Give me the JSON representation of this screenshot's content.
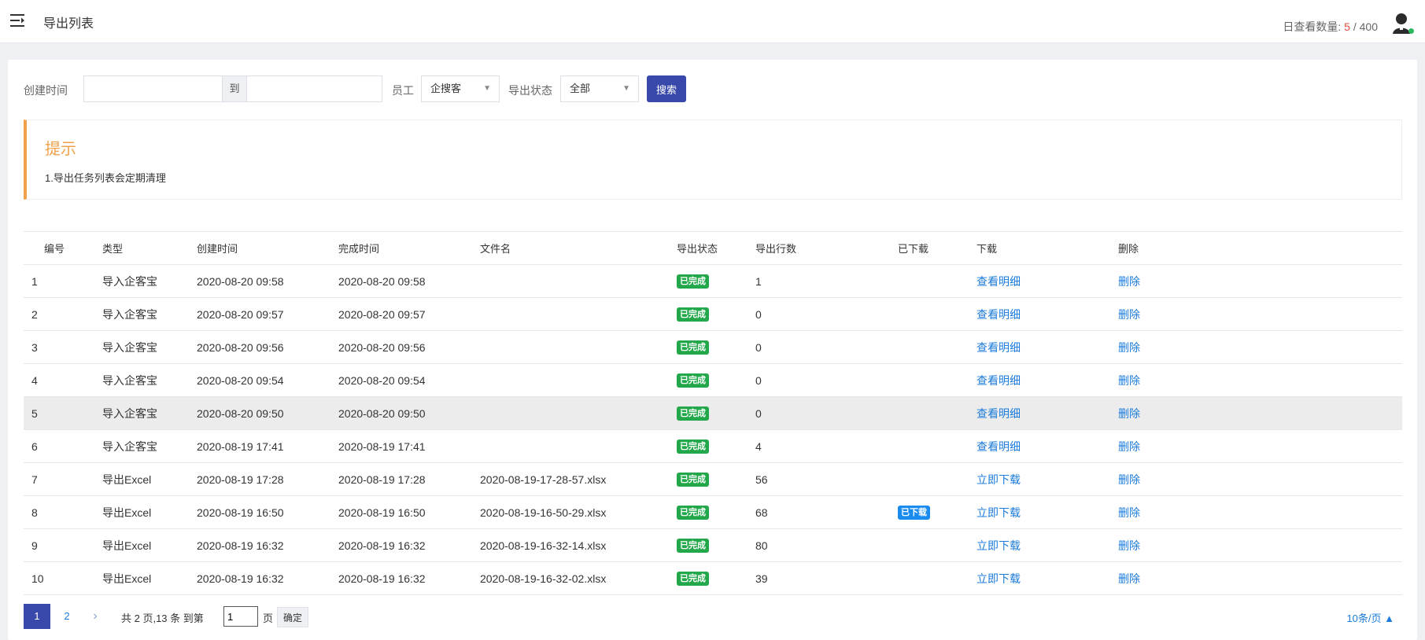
{
  "header": {
    "title": "导出列表",
    "quota_label": "日查看数量:",
    "quota_used": "5",
    "quota_sep": " / ",
    "quota_total": "400"
  },
  "filters": {
    "created_label": "创建时间",
    "date_start": "",
    "date_sep": "到",
    "date_end": "",
    "employee_label": "员工",
    "employee_value": "企搜客",
    "status_label": "导出状态",
    "status_value": "全部",
    "search_label": "搜索"
  },
  "tip": {
    "title": "提示",
    "text": "1.导出任务列表会定期清理"
  },
  "table": {
    "headers": [
      "编号",
      "类型",
      "创建时间",
      "完成时间",
      "文件名",
      "导出状态",
      "导出行数",
      "已下载",
      "下载",
      "删除"
    ],
    "rows": [
      {
        "id": "1",
        "type": "导入企客宝",
        "created": "2020-08-20 09:58",
        "finished": "2020-08-20 09:58",
        "file": "",
        "status": "已完成",
        "count": "1",
        "downloaded": "",
        "action": "查看明细",
        "delete": "删除"
      },
      {
        "id": "2",
        "type": "导入企客宝",
        "created": "2020-08-20 09:57",
        "finished": "2020-08-20 09:57",
        "file": "",
        "status": "已完成",
        "count": "0",
        "downloaded": "",
        "action": "查看明细",
        "delete": "删除"
      },
      {
        "id": "3",
        "type": "导入企客宝",
        "created": "2020-08-20 09:56",
        "finished": "2020-08-20 09:56",
        "file": "",
        "status": "已完成",
        "count": "0",
        "downloaded": "",
        "action": "查看明细",
        "delete": "删除"
      },
      {
        "id": "4",
        "type": "导入企客宝",
        "created": "2020-08-20 09:54",
        "finished": "2020-08-20 09:54",
        "file": "",
        "status": "已完成",
        "count": "0",
        "downloaded": "",
        "action": "查看明细",
        "delete": "删除"
      },
      {
        "id": "5",
        "type": "导入企客宝",
        "created": "2020-08-20 09:50",
        "finished": "2020-08-20 09:50",
        "file": "",
        "status": "已完成",
        "count": "0",
        "downloaded": "",
        "action": "查看明细",
        "delete": "删除"
      },
      {
        "id": "6",
        "type": "导入企客宝",
        "created": "2020-08-19 17:41",
        "finished": "2020-08-19 17:41",
        "file": "",
        "status": "已完成",
        "count": "4",
        "downloaded": "",
        "action": "查看明细",
        "delete": "删除"
      },
      {
        "id": "7",
        "type": "导出Excel",
        "created": "2020-08-19 17:28",
        "finished": "2020-08-19 17:28",
        "file": "2020-08-19-17-28-57.xlsx",
        "status": "已完成",
        "count": "56",
        "downloaded": "",
        "action": "立即下载",
        "delete": "删除"
      },
      {
        "id": "8",
        "type": "导出Excel",
        "created": "2020-08-19 16:50",
        "finished": "2020-08-19 16:50",
        "file": "2020-08-19-16-50-29.xlsx",
        "status": "已完成",
        "count": "68",
        "downloaded": "已下载",
        "action": "立即下载",
        "delete": "删除"
      },
      {
        "id": "9",
        "type": "导出Excel",
        "created": "2020-08-19 16:32",
        "finished": "2020-08-19 16:32",
        "file": "2020-08-19-16-32-14.xlsx",
        "status": "已完成",
        "count": "80",
        "downloaded": "",
        "action": "立即下载",
        "delete": "删除"
      },
      {
        "id": "10",
        "type": "导出Excel",
        "created": "2020-08-19 16:32",
        "finished": "2020-08-19 16:32",
        "file": "2020-08-19-16-32-02.xlsx",
        "status": "已完成",
        "count": "39",
        "downloaded": "",
        "action": "立即下载",
        "delete": "删除"
      }
    ]
  },
  "pagination": {
    "current": "1",
    "next_page": "2",
    "info": "共 2 页,13 条 到第",
    "goto_value": "1",
    "page_unit": "页",
    "confirm_label": "确定",
    "page_size": "10条/页 ▲"
  },
  "colors": {
    "primary": "#3949ab",
    "success": "#22a84a",
    "info": "#1a8cf0",
    "link": "#1a7bdc",
    "warning": "#f0a14a",
    "danger": "#e64b3c"
  }
}
